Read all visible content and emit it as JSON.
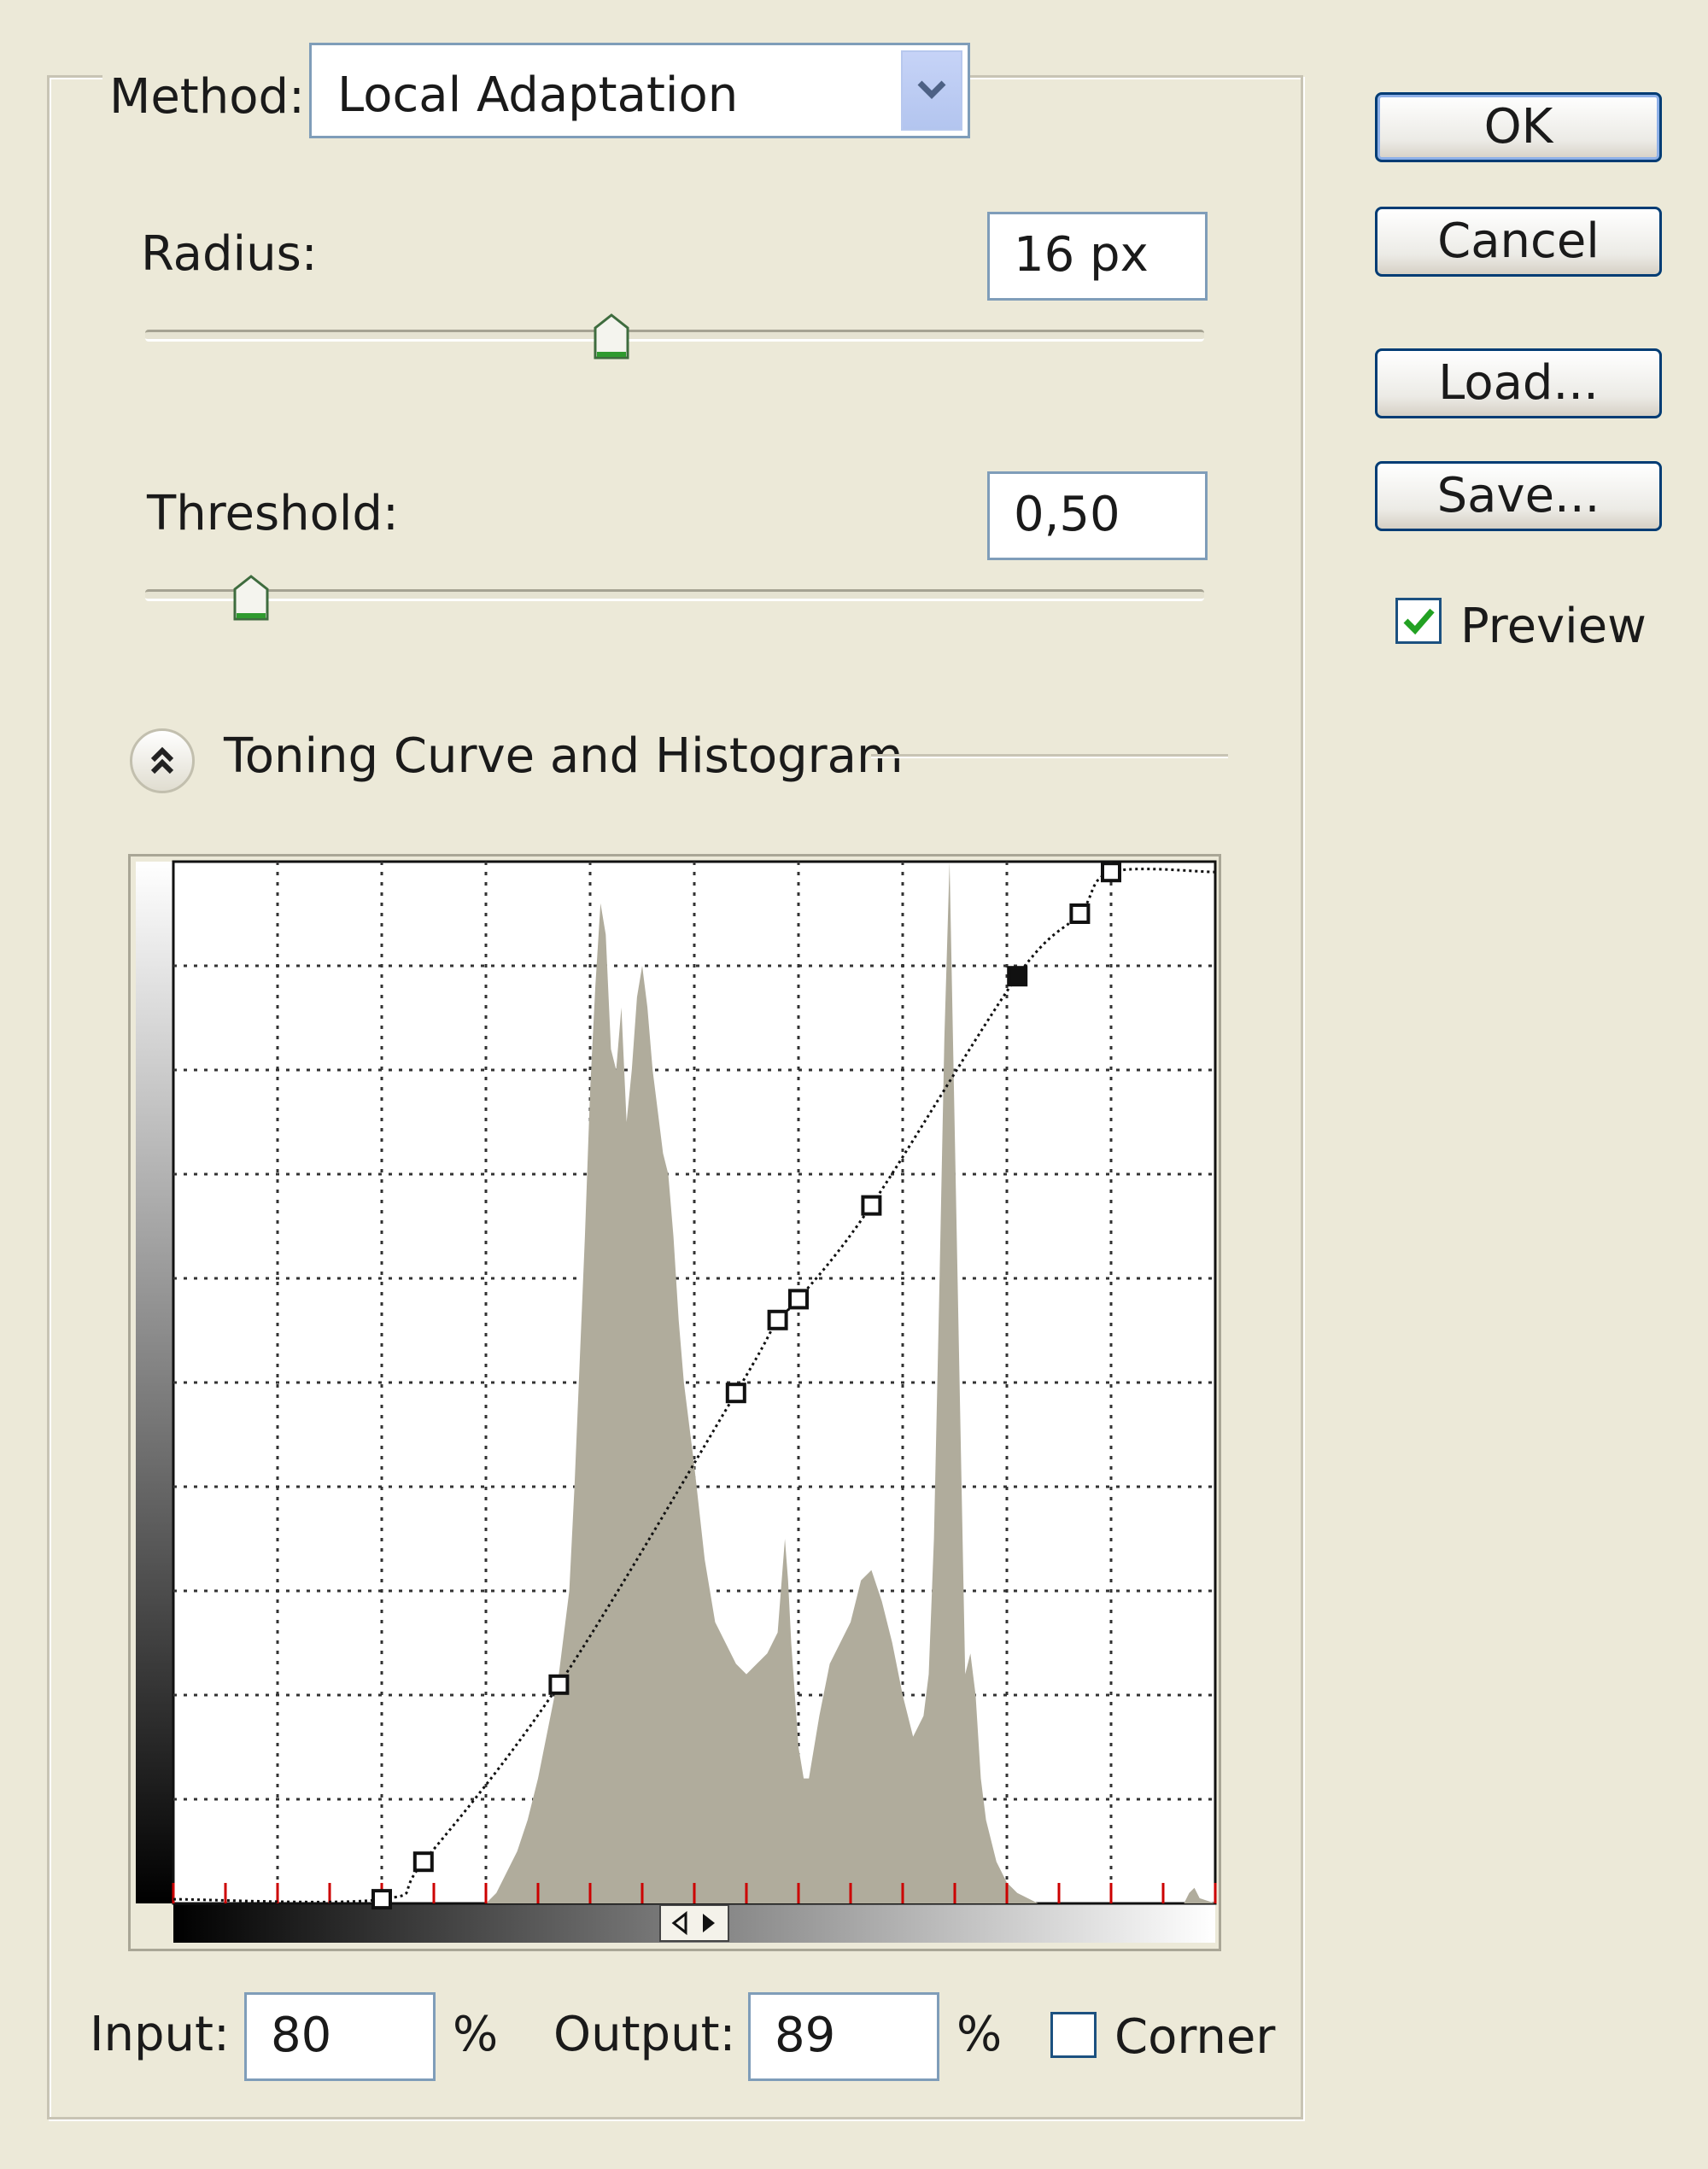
{
  "method": {
    "label": "Method:",
    "value": "Local Adaptation"
  },
  "radius": {
    "label": "Radius:",
    "value": "16 px",
    "slider_fraction": 0.44
  },
  "threshold": {
    "label": "Threshold:",
    "value": "0,50",
    "slider_fraction": 0.1
  },
  "section": {
    "title": "Toning Curve and Histogram",
    "collapse_icon": "double-chevron-up-icon"
  },
  "buttons": {
    "ok": "OK",
    "cancel": "Cancel",
    "load": "Load...",
    "save": "Save..."
  },
  "preview": {
    "label": "Preview",
    "checked": true
  },
  "io": {
    "input_label": "Input:",
    "input_value": "80",
    "input_unit": "%",
    "output_label": "Output:",
    "output_value": "89",
    "output_unit": "%"
  },
  "corner": {
    "label": "Corner",
    "checked": false
  },
  "colors": {
    "histogram": "#b0ac9c",
    "accent": "#2f8a2f",
    "border": "#7f9db9",
    "tick": "#cc0000"
  },
  "chart_data": {
    "type": "area",
    "grid": true,
    "xlim": [
      0,
      100
    ],
    "ylim": [
      0,
      100
    ],
    "histogram": {
      "x": [
        0,
        30,
        31,
        32,
        33,
        34,
        35,
        36,
        37,
        38,
        38.5,
        39,
        39.5,
        40,
        40.5,
        41,
        41.5,
        42,
        42.5,
        43,
        43.5,
        44,
        44.5,
        45,
        45.5,
        46,
        46.5,
        47,
        47.5,
        48,
        48.5,
        49,
        50,
        51,
        52,
        53,
        54,
        55,
        56,
        57,
        58,
        58.7,
        59,
        59.3,
        60,
        60.5,
        61,
        62,
        63,
        64,
        65,
        66,
        67,
        68,
        69,
        70,
        71,
        72,
        72.5,
        73,
        73.5,
        74,
        74.5,
        75,
        75.5,
        76,
        76.5,
        77,
        77.5,
        78,
        79,
        80,
        81,
        82,
        83,
        84,
        85,
        86,
        87,
        88,
        89,
        90,
        91,
        92,
        93,
        94,
        95,
        96,
        96.5,
        97,
        97.5,
        98,
        98.5,
        100
      ],
      "y": [
        0,
        0,
        1,
        3,
        5,
        8,
        12,
        17,
        22,
        30,
        40,
        52,
        64,
        78,
        88,
        96,
        93,
        82,
        80,
        86,
        75,
        80,
        87,
        90,
        86,
        80,
        76,
        72,
        70,
        64,
        56,
        50,
        42,
        33,
        27,
        25,
        23,
        22,
        23,
        24,
        26,
        35,
        31,
        25,
        15,
        12,
        12,
        18,
        23,
        25,
        27,
        31,
        32,
        29,
        25,
        20,
        16,
        18,
        22,
        35,
        58,
        83,
        100,
        74,
        48,
        22,
        24,
        20,
        12,
        8,
        4,
        2,
        1,
        0.5,
        0,
        0,
        0,
        0,
        0,
        0,
        0,
        0,
        0,
        0,
        0,
        0,
        0,
        0,
        0,
        0,
        1,
        1.5,
        0.5,
        0,
        0,
        0
      ]
    },
    "curve": {
      "points": [
        [
          0,
          0.4
        ],
        [
          20,
          0.4
        ],
        [
          24,
          4
        ],
        [
          37,
          21
        ],
        [
          54,
          49
        ],
        [
          58,
          56
        ],
        [
          60,
          58
        ],
        [
          67,
          67
        ],
        [
          81,
          89
        ],
        [
          87,
          95
        ],
        [
          90,
          99
        ],
        [
          100,
          99
        ]
      ],
      "selected_index": 8
    }
  }
}
